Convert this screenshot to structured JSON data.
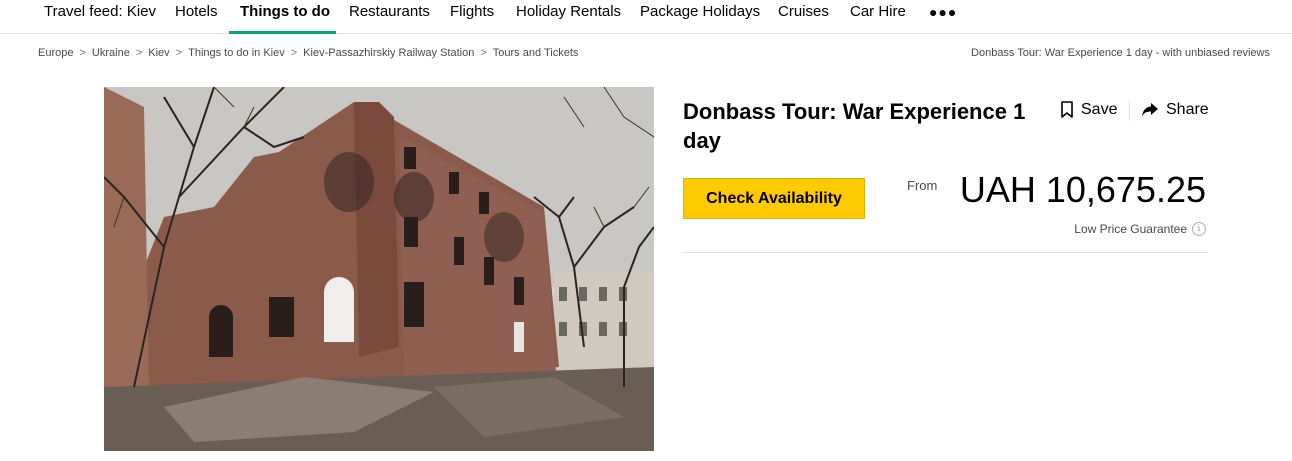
{
  "nav": {
    "items": [
      {
        "label": "Travel feed: Kiev",
        "active": false
      },
      {
        "label": "Hotels",
        "active": false
      },
      {
        "label": "Things to do",
        "active": true
      },
      {
        "label": "Restaurants",
        "active": false
      },
      {
        "label": "Flights",
        "active": false
      },
      {
        "label": "Holiday Rentals",
        "active": false
      },
      {
        "label": "Package Holidays",
        "active": false
      },
      {
        "label": "Cruises",
        "active": false
      },
      {
        "label": "Car Hire",
        "active": false
      }
    ],
    "more_label": "●●●"
  },
  "breadcrumb": {
    "items": [
      "Europe",
      "Ukraine",
      "Kiev",
      "Things to do in Kiev",
      "Kiev-Passazhirskiy Railway Station",
      "Tours and Tickets"
    ],
    "separator": ">",
    "right_text": "Donbass Tour: War Experience 1 day - with unbiased reviews"
  },
  "product": {
    "title": "Donbass Tour: War Experience 1 day",
    "save_label": "Save",
    "share_label": "Share",
    "check_label": "Check Availability",
    "from_label": "From",
    "price": "UAH 10,675.25",
    "guarantee_label": "Low Price Guarantee",
    "info_glyph": "i"
  },
  "icons": {
    "save": "bookmark-icon",
    "share": "share-arrow-icon",
    "info": "info-icon"
  },
  "colors": {
    "accent": "#00aa6c",
    "button": "#ffca00"
  }
}
